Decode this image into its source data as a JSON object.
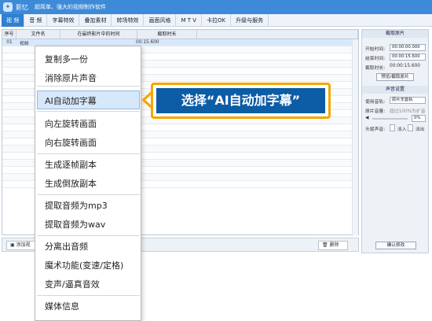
{
  "app": {
    "name": "影忆",
    "subtitle": "超简单、强大的视频制作软件"
  },
  "menu": {
    "tabs": [
      "视 频",
      "音 频",
      "字幕特效",
      "叠加素材",
      "转场特效",
      "画面风格",
      "M T V",
      "卡拉OK",
      "升级与服务"
    ]
  },
  "table": {
    "headers": [
      "序号",
      "文件名",
      "在最终影片中的时间",
      "截取时长"
    ],
    "row": {
      "index": "01",
      "filename": "视频",
      "time": "00:15.600"
    }
  },
  "bottom": {
    "add_label": "添加视",
    "delete_label": "删除"
  },
  "panel": {
    "clip_title": "截取原片",
    "start_label": "开始时间:",
    "start_value": "00:00:00.000",
    "end_label": "结束时间:",
    "end_value": "00:00:15.600",
    "duration_label": "截取时长:",
    "duration_value": "00:00:15.600",
    "preview_button": "预览/截取原片",
    "audio_title": "声音设置",
    "track_label": "使用音轨:",
    "track_value": "原片无音轨",
    "volume_label": "原片音量:",
    "volume_hint": "超过100%为扩音",
    "volume_value": "0%",
    "fade_label": "头尾声音:",
    "fade_in": "淡入",
    "fade_out": "淡出",
    "confirm_button": "确认修改"
  },
  "context_menu": {
    "items": [
      "复制多一份",
      "消除原片声音",
      "AI自动加字幕",
      "向左旋转画面",
      "向右旋转画面",
      "生成逐帧副本",
      "生成倒放副本",
      "提取音频为mp3",
      "提取音频为wav",
      "分离出音频",
      "魔术功能(变速/定格)",
      "变声/逼真音效",
      "媒体信息"
    ]
  },
  "callout": {
    "text": "选择“AI自动加字幕”"
  },
  "colors": {
    "accent": "#3d8ad8",
    "highlight": "#d7e8fb",
    "callout_border": "#f4a600",
    "callout_bg": "#0c5ca6"
  }
}
